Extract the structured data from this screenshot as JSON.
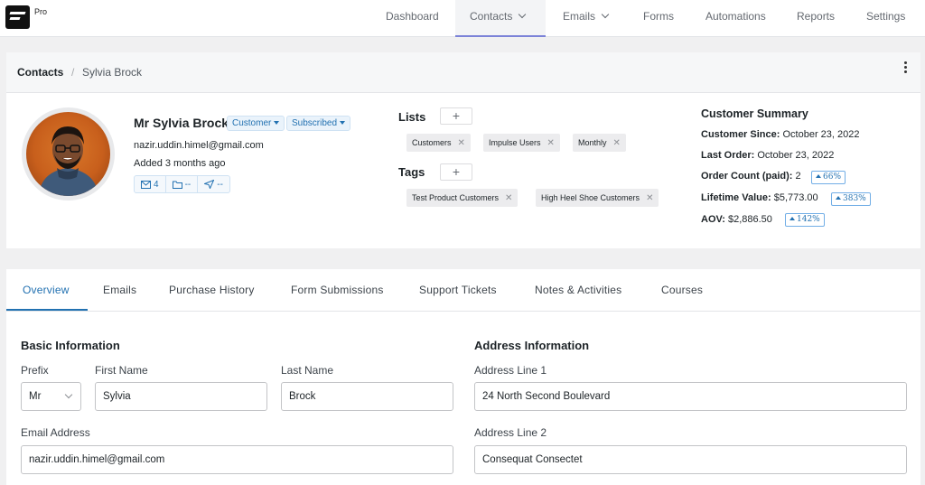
{
  "app": {
    "pro_label": "Pro"
  },
  "nav": {
    "items": [
      {
        "label": "Dashboard"
      },
      {
        "label": "Contacts"
      },
      {
        "label": "Emails"
      },
      {
        "label": "Forms"
      },
      {
        "label": "Automations"
      },
      {
        "label": "Reports"
      },
      {
        "label": "Settings"
      }
    ],
    "active": "Contacts"
  },
  "breadcrumb": {
    "root": "Contacts",
    "separator": "/",
    "current": "Sylvia Brock"
  },
  "contact": {
    "name": "Mr Sylvia Brock",
    "type_label": "Customer",
    "status_label": "Subscribed",
    "email": "nazir.uddin.himel@gmail.com",
    "added": "Added 3 months ago",
    "stats": {
      "emails": "4",
      "folders": "--",
      "sent": "--"
    }
  },
  "lists": {
    "title": "Lists",
    "items": [
      "Customers",
      "Impulse Users",
      "Monthly"
    ]
  },
  "tags": {
    "title": "Tags",
    "items": [
      "Test Product Customers",
      "High Heel Shoe Customers"
    ]
  },
  "summary": {
    "title": "Customer Summary",
    "customer_since_label": "Customer Since:",
    "customer_since": "October 23, 2022",
    "last_order_label": "Last Order:",
    "last_order": "October 23, 2022",
    "order_count_label": "Order Count (paid):",
    "order_count": "2",
    "order_count_badge": "66%",
    "lifetime_value_label": "Lifetime Value:",
    "lifetime_value": "$5,773.00",
    "lifetime_value_badge": "383%",
    "aov_label": "AOV:",
    "aov": "$2,886.50",
    "aov_badge": "142%"
  },
  "tabs": {
    "items": [
      "Overview",
      "Emails",
      "Purchase History",
      "Form Submissions",
      "Support Tickets",
      "Notes & Activities",
      "Courses"
    ],
    "active": "Overview"
  },
  "basic_info": {
    "title": "Basic Information",
    "prefix_label": "Prefix",
    "prefix_value": "Mr",
    "first_name_label": "First Name",
    "first_name_value": "Sylvia",
    "last_name_label": "Last Name",
    "last_name_value": "Brock",
    "email_label": "Email Address",
    "email_value": "nazir.uddin.himel@gmail.com"
  },
  "address_info": {
    "title": "Address Information",
    "line1_label": "Address Line 1",
    "line1_value": "24 North Second Boulevard",
    "line2_label": "Address Line 2",
    "line2_value": "Consequat Consectet"
  },
  "colors": {
    "accent": "#2271b1",
    "nav_active_underline": "#7c83d8"
  }
}
